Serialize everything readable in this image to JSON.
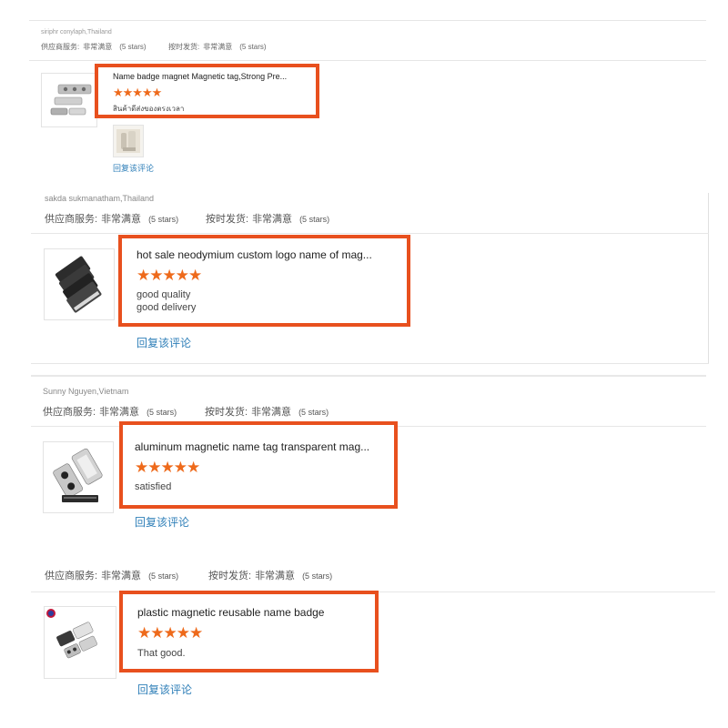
{
  "labels": {
    "supplier_service": "供应商服务:",
    "on_time_shipping": "按时发货:",
    "very_satisfied": "非常满意",
    "rating_count": "(5 stars)",
    "reply": "回复该评论",
    "stars": "★★★★★"
  },
  "reviews": [
    {
      "reviewer": "siriphr conylaph,Thailand",
      "product_title": "Name badge magnet Magnetic tag,Strong Pre...",
      "rating": 5,
      "comment": [
        "สินค้าดีส่งของตรงเวลา"
      ],
      "has_photo": true
    },
    {
      "reviewer": "sakda sukmanatham,Thailand",
      "product_title": "hot sale neodymium custom logo name of mag...",
      "rating": 5,
      "comment": [
        "good quality",
        "good delivery"
      ]
    },
    {
      "reviewer": "Sunny Nguyen,Vietnam",
      "product_title": "aluminum magnetic name tag transparent mag...",
      "rating": 5,
      "comment": [
        "satisfied"
      ]
    },
    {
      "reviewer": "",
      "product_title": "plastic magnetic reusable name badge",
      "rating": 5,
      "comment": [
        "That good."
      ]
    }
  ],
  "colors": {
    "highlight": "#e8501e",
    "stars": "#ee6a1b",
    "link": "#2f7fb8"
  }
}
